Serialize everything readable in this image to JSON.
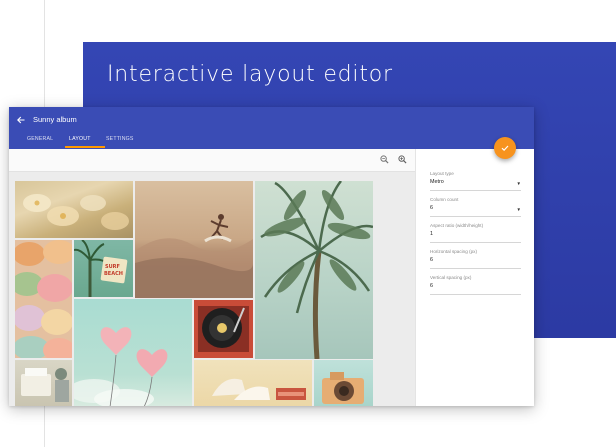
{
  "hero": {
    "title": "Interactive layout editor"
  },
  "app": {
    "title": "Sunny album",
    "tabs": [
      {
        "label": "GENERAL",
        "active": false
      },
      {
        "label": "LAYOUT",
        "active": true
      },
      {
        "label": "SETTINGS",
        "active": false
      }
    ],
    "fab_icon": "check-icon"
  },
  "toolbar": {
    "icons": [
      "zoom-out-icon",
      "zoom-in-icon"
    ]
  },
  "photos": [
    {
      "name": "flowers-photo"
    },
    {
      "name": "surfer-photo"
    },
    {
      "name": "palm-tree-photo"
    },
    {
      "name": "macarons-photo"
    },
    {
      "name": "surf-beach-sign-photo"
    },
    {
      "name": "heart-balloons-photo"
    },
    {
      "name": "record-player-photo"
    },
    {
      "name": "typewriter-photo"
    },
    {
      "name": "shoes-photo"
    },
    {
      "name": "camera-photo"
    }
  ],
  "settings": {
    "layout_type": {
      "label": "Layout type",
      "value": "Metro"
    },
    "column_count": {
      "label": "Column count",
      "value": "6"
    },
    "aspect_ratio": {
      "label": "Aspect ratio (width/height)",
      "value": "1"
    },
    "horizontal_spacing": {
      "label": "Horizontal spacing (px)",
      "value": "6"
    },
    "vertical_spacing": {
      "label": "Vertical spacing (px)",
      "value": "6"
    }
  },
  "colors": {
    "hero_bg": "#3446b4",
    "appbar_bg": "#3a4cb5",
    "accent": "#f7931e",
    "tab_indicator": "#ff9800"
  }
}
